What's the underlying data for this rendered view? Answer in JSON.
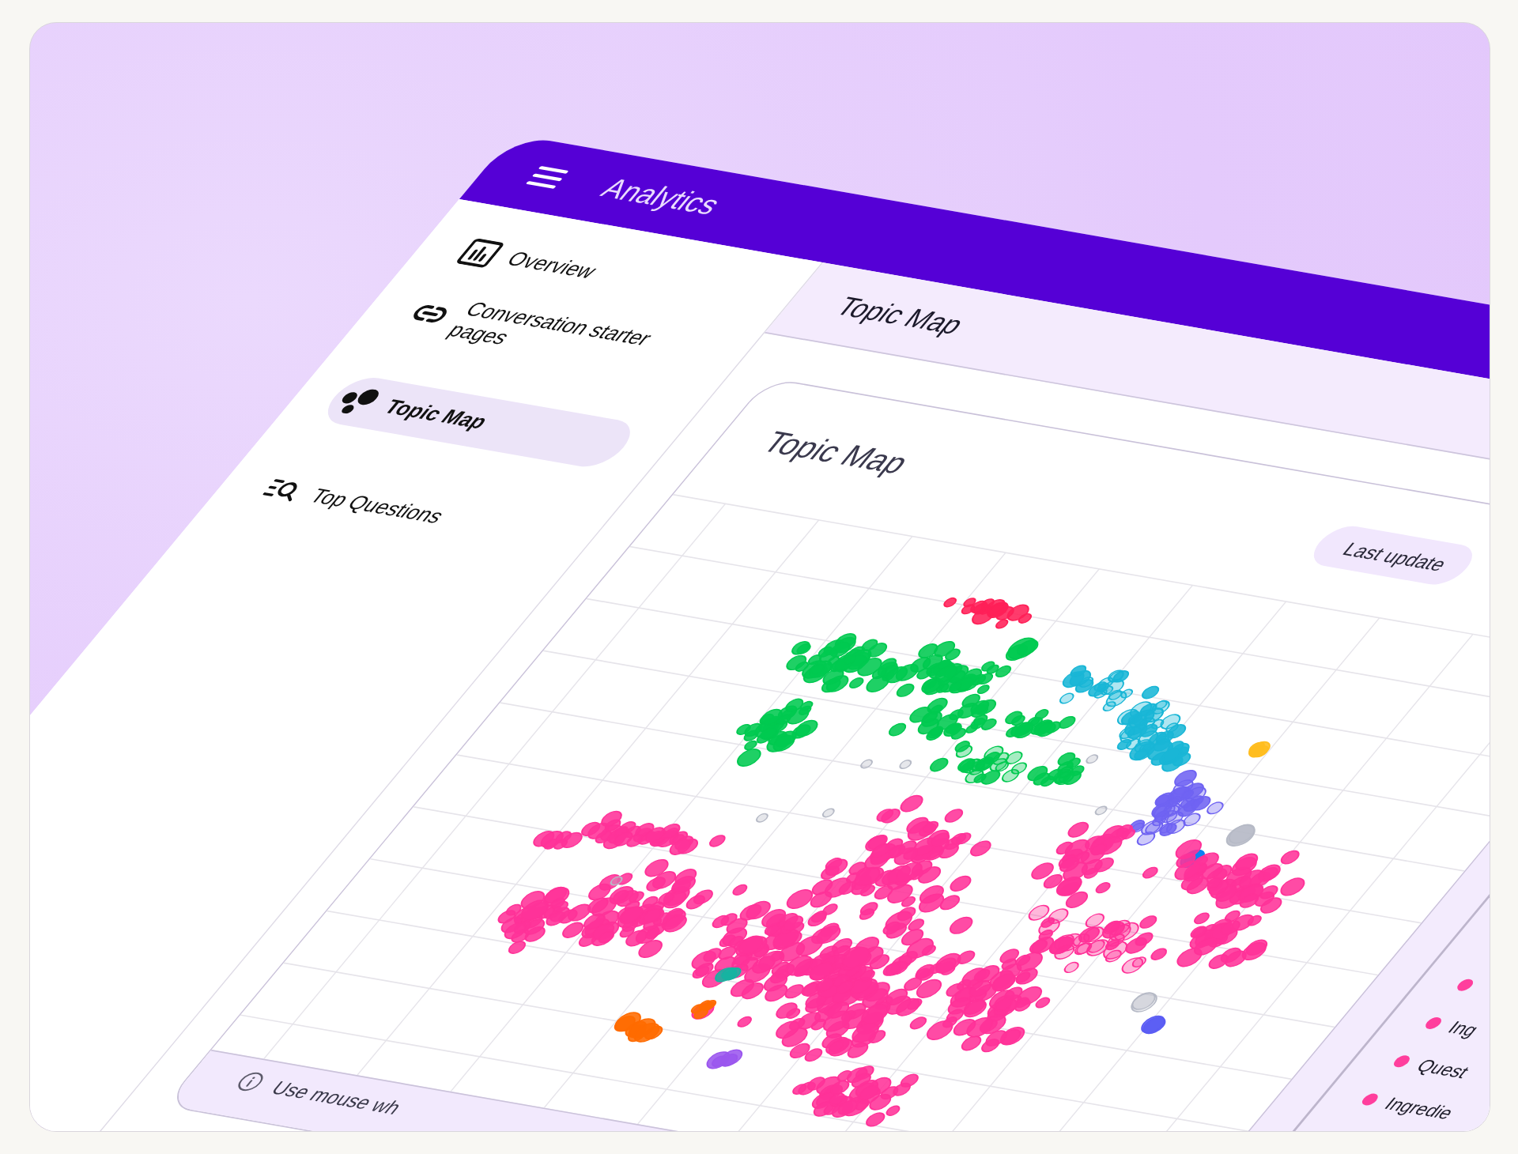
{
  "header": {
    "title": "Analytics"
  },
  "sidebar": {
    "items": [
      {
        "label": "Overview",
        "selected": false
      },
      {
        "label": "Conversation starter pages",
        "selected": false
      },
      {
        "label": "Topic Map",
        "selected": true
      },
      {
        "label": "Top Questions",
        "selected": false
      }
    ]
  },
  "content_header": {
    "title": "Topic Map"
  },
  "card": {
    "title": "Topic Map",
    "last_update": "Last update",
    "legend": {
      "items": [
        {
          "color": "#ff3e9d"
        },
        {
          "label": "Ing",
          "color": "#ff3e9d"
        },
        {
          "label": "Quest",
          "color": "#ff3e9d"
        },
        {
          "label": "Ingredie",
          "color": "#ff3e9d"
        }
      ]
    },
    "hint": "Use mouse wh"
  }
}
